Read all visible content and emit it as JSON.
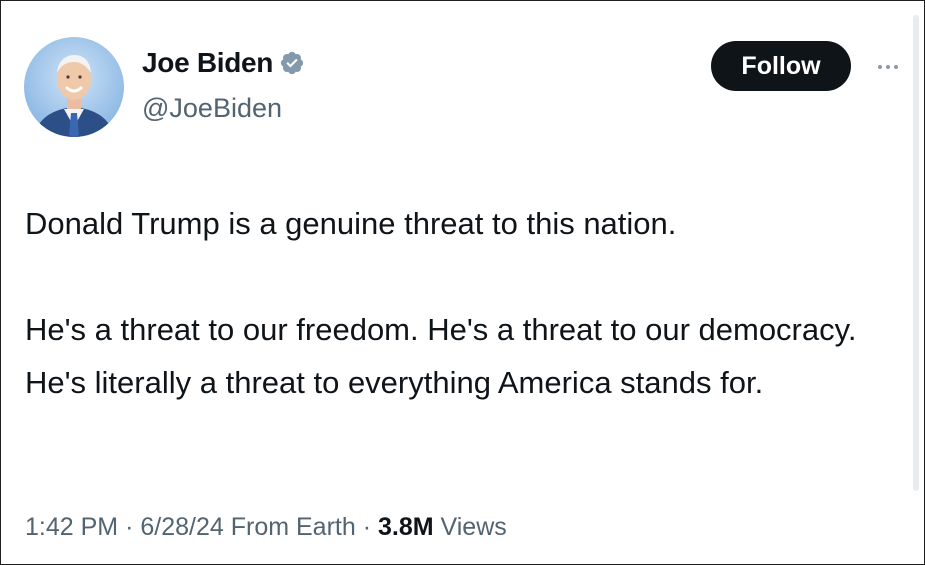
{
  "colors": {
    "text_primary": "#0f1419",
    "text_secondary": "#536471",
    "verified_badge": "#829aab",
    "follow_button_bg": "#0f1419"
  },
  "author": {
    "display_name": "Joe Biden",
    "handle": "@JoeBiden",
    "verified_icon": "verified-badge-icon",
    "avatar_icon": "profile-photo-avatar"
  },
  "actions": {
    "follow_label": "Follow",
    "more_icon": "more-options-icon"
  },
  "tweet": {
    "paragraphs": [
      "Donald Trump is a genuine threat to this nation.",
      "He's a threat to our freedom. He's a threat to our democracy. He's literally a threat to everything America stands for."
    ]
  },
  "meta": {
    "time": "1:42 PM",
    "separator": "·",
    "date": "6/28/24",
    "source": "From Earth",
    "views_count": "3.8M",
    "views_label": "Views"
  }
}
